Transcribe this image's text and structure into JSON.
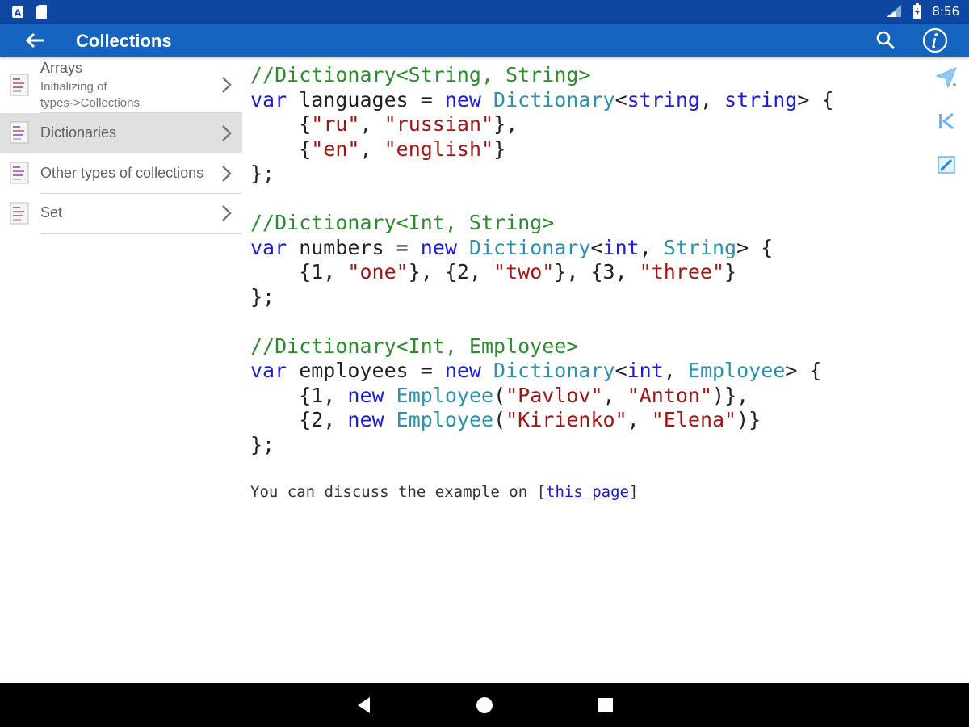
{
  "status": {
    "time": "8:56"
  },
  "appbar": {
    "title": "Collections"
  },
  "sidebar": {
    "items": [
      {
        "label": "Arrays",
        "sub": "Initializing of\ntypes->Collections",
        "active": false
      },
      {
        "label": "Dictionaries",
        "active": true
      },
      {
        "label": "Other types of collections",
        "active": false
      },
      {
        "label": "Set",
        "active": false
      }
    ]
  },
  "code": {
    "lines": [
      [
        {
          "t": "//Dictionary<String, String>",
          "c": "cm"
        }
      ],
      [
        {
          "t": "var",
          "c": "kw"
        },
        {
          "t": " languages = ",
          "c": ""
        },
        {
          "t": "new",
          "c": "kw"
        },
        {
          "t": " ",
          "c": ""
        },
        {
          "t": "Dictionary",
          "c": "ty"
        },
        {
          "t": "<",
          "c": ""
        },
        {
          "t": "string",
          "c": "kw"
        },
        {
          "t": ", ",
          "c": ""
        },
        {
          "t": "string",
          "c": "kw"
        },
        {
          "t": "> {",
          "c": ""
        }
      ],
      [
        {
          "t": "    {",
          "c": ""
        },
        {
          "t": "\"ru\"",
          "c": "st"
        },
        {
          "t": ", ",
          "c": ""
        },
        {
          "t": "\"russian\"",
          "c": "st"
        },
        {
          "t": "},",
          "c": ""
        }
      ],
      [
        {
          "t": "    {",
          "c": ""
        },
        {
          "t": "\"en\"",
          "c": "st"
        },
        {
          "t": ", ",
          "c": ""
        },
        {
          "t": "\"english\"",
          "c": "st"
        },
        {
          "t": "}",
          "c": ""
        }
      ],
      [
        {
          "t": "};",
          "c": ""
        }
      ],
      [],
      [
        {
          "t": "//Dictionary<Int, String>",
          "c": "cm"
        }
      ],
      [
        {
          "t": "var",
          "c": "kw"
        },
        {
          "t": " numbers = ",
          "c": ""
        },
        {
          "t": "new",
          "c": "kw"
        },
        {
          "t": " ",
          "c": ""
        },
        {
          "t": "Dictionary",
          "c": "ty"
        },
        {
          "t": "<",
          "c": ""
        },
        {
          "t": "int",
          "c": "kw"
        },
        {
          "t": ", ",
          "c": ""
        },
        {
          "t": "String",
          "c": "ty"
        },
        {
          "t": "> {",
          "c": ""
        }
      ],
      [
        {
          "t": "    {1, ",
          "c": ""
        },
        {
          "t": "\"one\"",
          "c": "st"
        },
        {
          "t": "}, {2, ",
          "c": ""
        },
        {
          "t": "\"two\"",
          "c": "st"
        },
        {
          "t": "}, {3, ",
          "c": ""
        },
        {
          "t": "\"three\"",
          "c": "st"
        },
        {
          "t": "}",
          "c": ""
        }
      ],
      [
        {
          "t": "};",
          "c": ""
        }
      ],
      [],
      [
        {
          "t": "//Dictionary<Int, Employee>",
          "c": "cm"
        }
      ],
      [
        {
          "t": "var",
          "c": "kw"
        },
        {
          "t": " employees = ",
          "c": ""
        },
        {
          "t": "new",
          "c": "kw"
        },
        {
          "t": " ",
          "c": ""
        },
        {
          "t": "Dictionary",
          "c": "ty"
        },
        {
          "t": "<",
          "c": ""
        },
        {
          "t": "int",
          "c": "kw"
        },
        {
          "t": ", ",
          "c": ""
        },
        {
          "t": "Employee",
          "c": "ty"
        },
        {
          "t": "> {",
          "c": ""
        }
      ],
      [
        {
          "t": "    {1, ",
          "c": ""
        },
        {
          "t": "new",
          "c": "kw"
        },
        {
          "t": " ",
          "c": ""
        },
        {
          "t": "Employee",
          "c": "ty"
        },
        {
          "t": "(",
          "c": ""
        },
        {
          "t": "\"Pavlov\"",
          "c": "st"
        },
        {
          "t": ", ",
          "c": ""
        },
        {
          "t": "\"Anton\"",
          "c": "st"
        },
        {
          "t": ")},",
          "c": ""
        }
      ],
      [
        {
          "t": "    {2, ",
          "c": ""
        },
        {
          "t": "new",
          "c": "kw"
        },
        {
          "t": " ",
          "c": ""
        },
        {
          "t": "Employee",
          "c": "ty"
        },
        {
          "t": "(",
          "c": ""
        },
        {
          "t": "\"Kirienko\"",
          "c": "st"
        },
        {
          "t": ", ",
          "c": ""
        },
        {
          "t": "\"Elena\"",
          "c": "st"
        },
        {
          "t": ")}",
          "c": ""
        }
      ],
      [
        {
          "t": "};",
          "c": ""
        }
      ]
    ]
  },
  "discussion": {
    "prefix": "You can discuss the example on [",
    "link": "this page",
    "suffix": "]"
  },
  "colors": {
    "status_bar": "#0d47a1",
    "app_bar": "#1565c0",
    "comment": "#2e8b2e",
    "keyword": "#1a1ae6",
    "type": "#2b91af",
    "string": "#a31515",
    "active_item": "#e0e0e0"
  },
  "icons": {
    "appbar": [
      "back-arrow-icon",
      "search-icon",
      "info-icon"
    ],
    "rail": [
      "send-icon",
      "skip-to-start-icon",
      "edit-icon"
    ],
    "navbar": [
      "back-triangle-icon",
      "home-circle-icon",
      "recents-square-icon"
    ]
  }
}
